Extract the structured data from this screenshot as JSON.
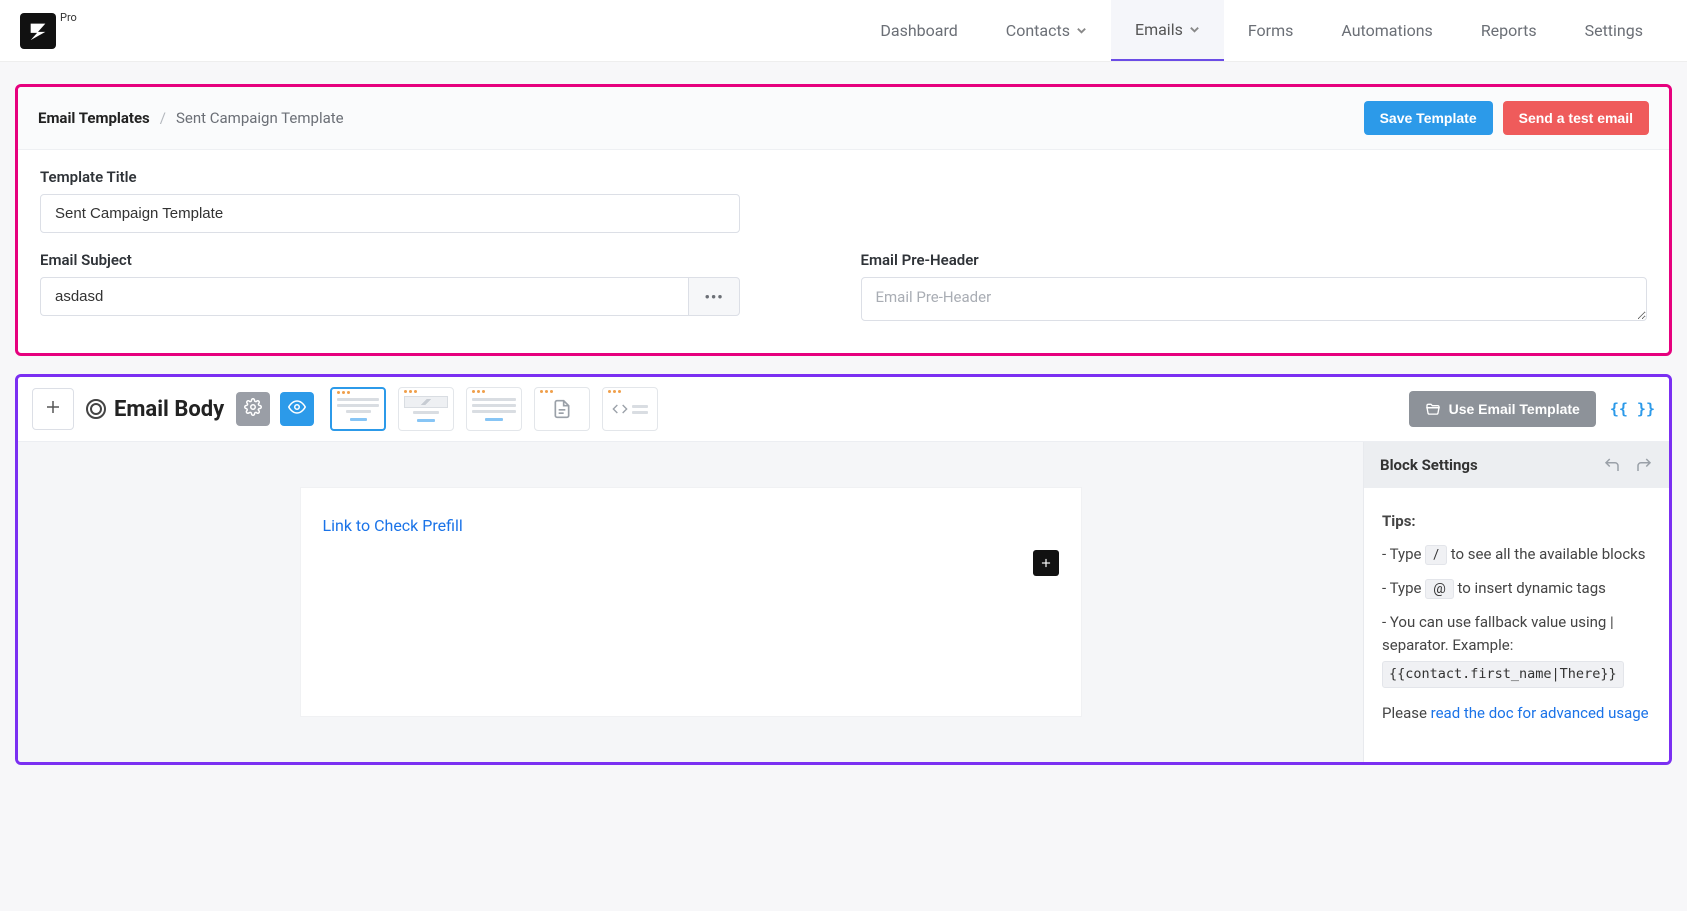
{
  "brand": {
    "badge": "Pro"
  },
  "nav": {
    "items": [
      {
        "label": "Dashboard",
        "has_chevron": false
      },
      {
        "label": "Contacts",
        "has_chevron": true
      },
      {
        "label": "Emails",
        "has_chevron": true,
        "active": true
      },
      {
        "label": "Forms",
        "has_chevron": false
      },
      {
        "label": "Automations",
        "has_chevron": false
      },
      {
        "label": "Reports",
        "has_chevron": false
      },
      {
        "label": "Settings",
        "has_chevron": false
      }
    ]
  },
  "breadcrumb": {
    "root": "Email Templates",
    "sep": "/",
    "leaf": "Sent Campaign Template"
  },
  "actions": {
    "save": "Save Template",
    "test": "Send a test email"
  },
  "fields": {
    "title_label": "Template Title",
    "title_value": "Sent Campaign Template",
    "subject_label": "Email Subject",
    "subject_value": "asdasd",
    "subject_more": "•••",
    "preheader_label": "Email Pre-Header",
    "preheader_placeholder": "Email Pre-Header",
    "preheader_value": ""
  },
  "body": {
    "title": "Email Body",
    "use_template": "Use Email Template",
    "curly": "{{ }}",
    "canvas_link": "Link to Check Prefill"
  },
  "sidebar": {
    "title": "Block Settings",
    "tips_heading": "Tips:",
    "tip1_pre": "- Type ",
    "tip1_key": "/",
    "tip1_post": " to see all the available blocks",
    "tip2_pre": "- Type ",
    "tip2_key": "@",
    "tip2_post": " to insert dynamic tags",
    "tip3": "- You can use fallback value using | separator. Example:",
    "tip3_code": "{{contact.first_name|There}}",
    "doc_pre": "Please ",
    "doc_link": "read the doc for advanced usage"
  }
}
